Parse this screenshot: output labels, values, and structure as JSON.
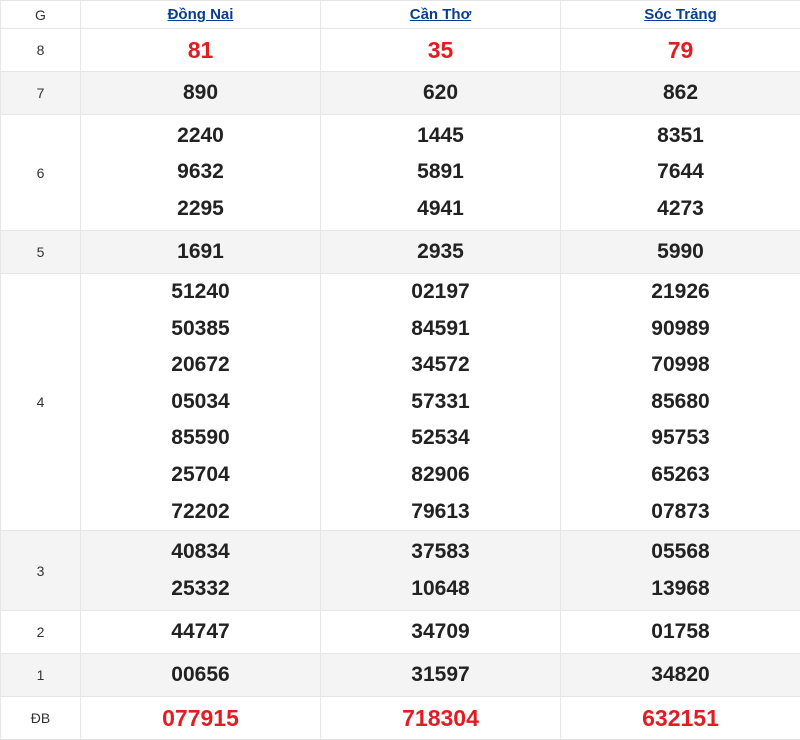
{
  "header": {
    "prize_col": "G",
    "provinces": [
      "Đồng Nai",
      "Cần Thơ",
      "Sóc Trăng"
    ]
  },
  "rows": [
    {
      "prize": "8",
      "values": [
        [
          "81"
        ],
        [
          "35"
        ],
        [
          "79"
        ]
      ]
    },
    {
      "prize": "7",
      "values": [
        [
          "890"
        ],
        [
          "620"
        ],
        [
          "862"
        ]
      ]
    },
    {
      "prize": "6",
      "values": [
        [
          "2240",
          "9632",
          "2295"
        ],
        [
          "1445",
          "5891",
          "4941"
        ],
        [
          "8351",
          "7644",
          "4273"
        ]
      ]
    },
    {
      "prize": "5",
      "values": [
        [
          "1691"
        ],
        [
          "2935"
        ],
        [
          "5990"
        ]
      ]
    },
    {
      "prize": "4",
      "values": [
        [
          "51240",
          "50385",
          "20672",
          "05034",
          "85590",
          "25704",
          "72202"
        ],
        [
          "02197",
          "84591",
          "34572",
          "57331",
          "52534",
          "82906",
          "79613"
        ],
        [
          "21926",
          "90989",
          "70998",
          "85680",
          "95753",
          "65263",
          "07873"
        ]
      ]
    },
    {
      "prize": "3",
      "values": [
        [
          "40834",
          "25332"
        ],
        [
          "37583",
          "10648"
        ],
        [
          "05568",
          "13968"
        ]
      ]
    },
    {
      "prize": "2",
      "values": [
        [
          "44747"
        ],
        [
          "34709"
        ],
        [
          "01758"
        ]
      ]
    },
    {
      "prize": "1",
      "values": [
        [
          "00656"
        ],
        [
          "31597"
        ],
        [
          "34820"
        ]
      ]
    },
    {
      "prize": "ĐB",
      "values": [
        [
          "077915"
        ],
        [
          "718304"
        ],
        [
          "632151"
        ]
      ]
    }
  ],
  "colors": {
    "highlight": "#e21c23",
    "link": "#0a3d91",
    "alt_row": "#f4f4f4"
  }
}
